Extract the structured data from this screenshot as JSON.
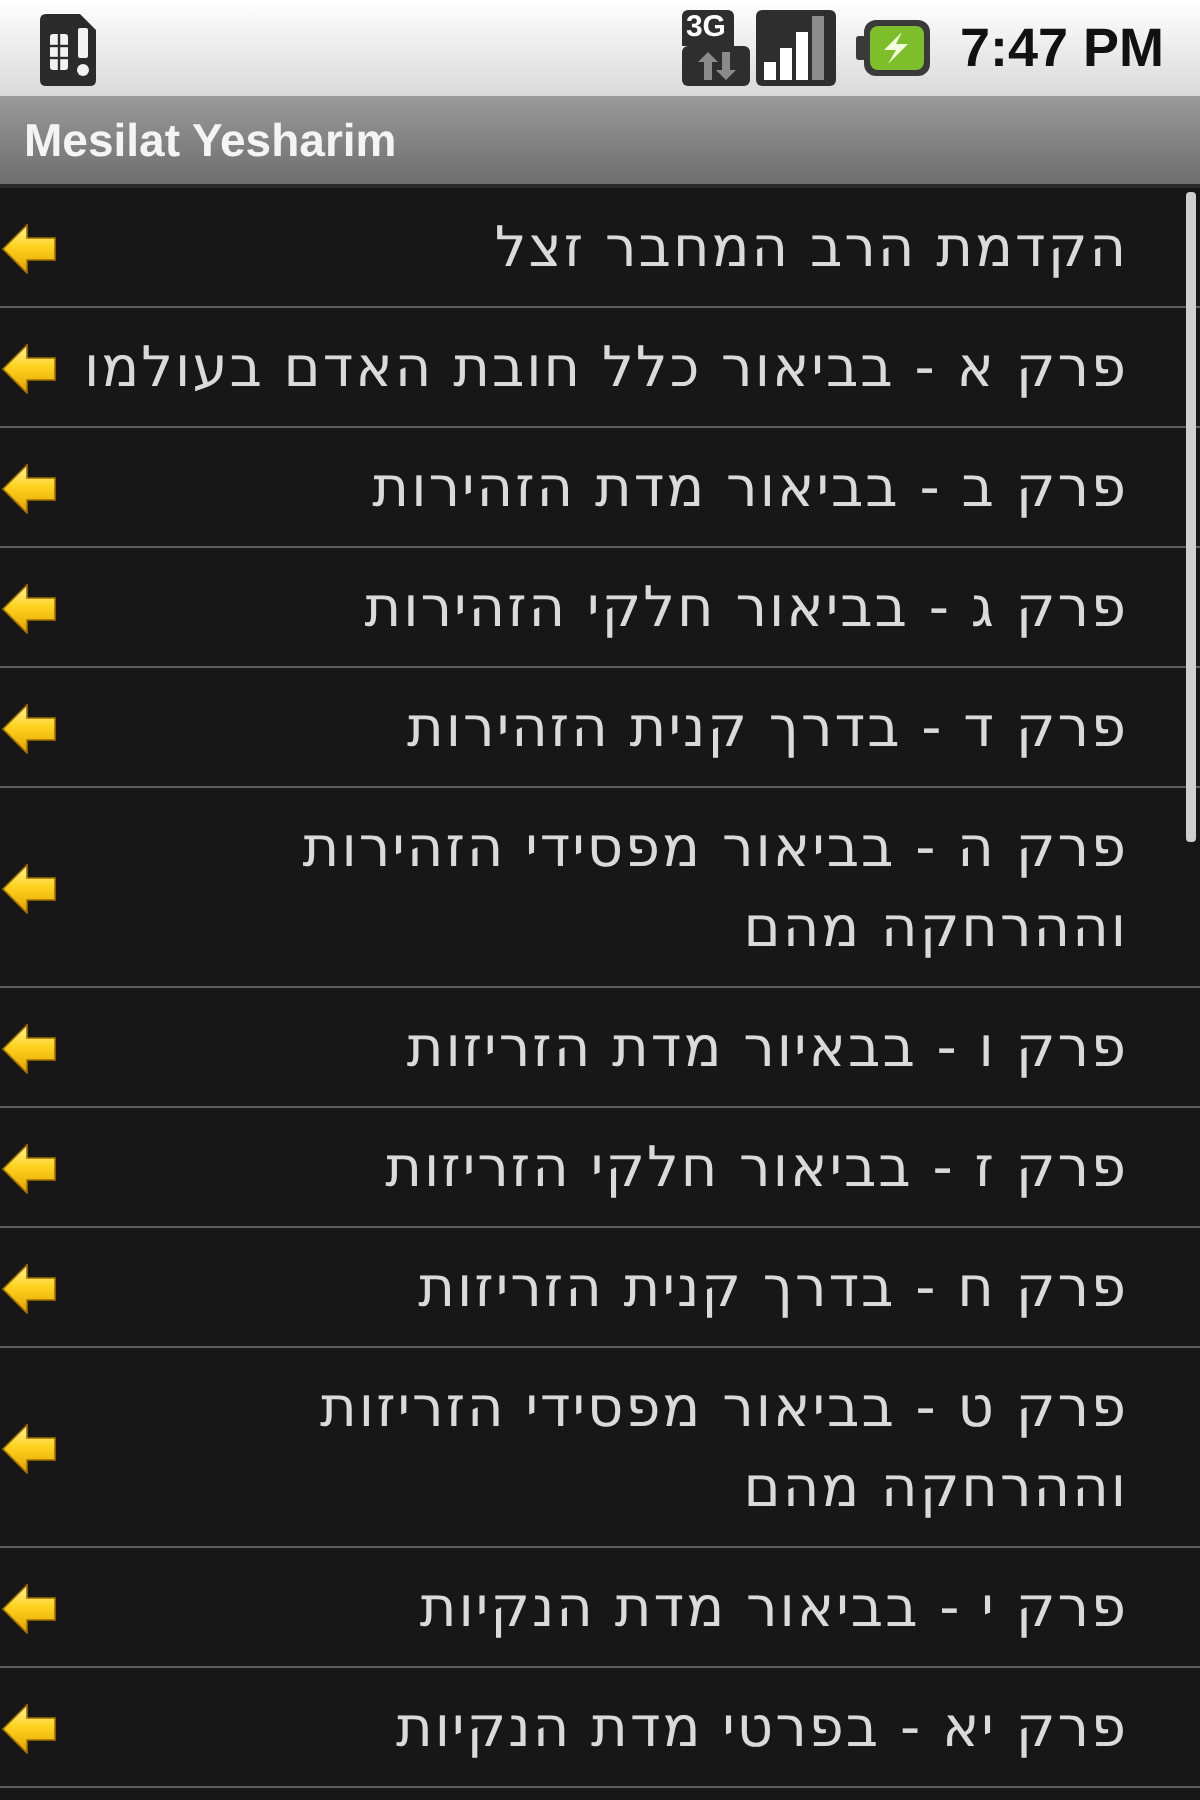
{
  "status_bar": {
    "network_type": "3G",
    "time": "7:47 PM"
  },
  "title_bar": {
    "title": "Mesilat Yesharim"
  },
  "chapters": [
    {
      "title": "הקדמת הרב המחבר זצל"
    },
    {
      "title": "פרק א - בביאור כלל חובת האדם בעולמו"
    },
    {
      "title": "פרק ב - בביאור מדת הזהירות"
    },
    {
      "title": "פרק ג - בביאור חלקי הזהירות"
    },
    {
      "title": "פרק ד - בדרך קנית הזהירות"
    },
    {
      "title": "פרק ה - בביאור מפסידי הזהירות וההרחקה מהם"
    },
    {
      "title": "פרק ו - בבאיור מדת הזריזות"
    },
    {
      "title": "פרק ז - בביאור חלקי הזריזות"
    },
    {
      "title": "פרק ח - בדרך קנית הזריזות"
    },
    {
      "title": "פרק ט - בביאור מפסידי הזריזות וההרחקה מהם"
    },
    {
      "title": "פרק י - בביאור מדת הנקיות"
    },
    {
      "title": "פרק יא - בפרטי מדת הנקיות"
    }
  ]
}
